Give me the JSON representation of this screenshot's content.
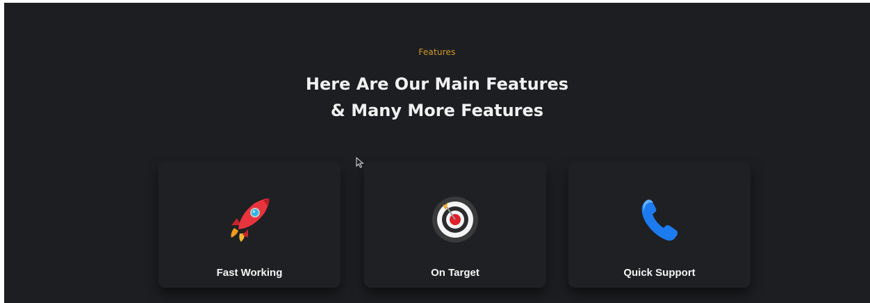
{
  "section": {
    "eyebrow": "Features",
    "heading_line1": "Here Are Our Main Features",
    "heading_line2": "& Many More Features"
  },
  "cards": [
    {
      "label": "Fast Working",
      "icon": "rocket-icon"
    },
    {
      "label": "On Target",
      "icon": "target-icon"
    },
    {
      "label": "Quick Support",
      "icon": "phone-icon"
    }
  ],
  "colors": {
    "background": "#1d1e21",
    "card": "#1f2023",
    "accent": "#d29a2a",
    "text": "#f1f1f1"
  }
}
